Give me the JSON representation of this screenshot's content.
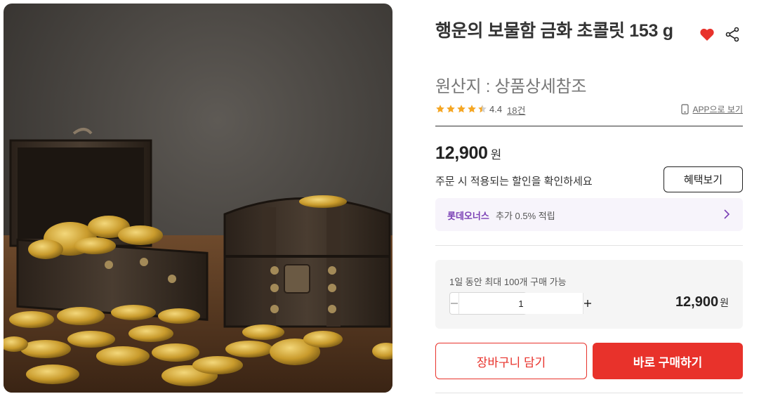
{
  "product": {
    "title": "행운의 보물함 금화 초콜릿 153 g",
    "origin": "원산지 : 상품상세참조",
    "image_alt": "treasure chests with gold coin chocolates"
  },
  "rating": {
    "score": "4.4",
    "stars": 4.4,
    "review_count": "18건",
    "star_color": "#f5a623"
  },
  "app_view_label": "APP으로 보기",
  "price": {
    "amount": "12,900",
    "unit": "원"
  },
  "discount": {
    "message": "주문 시 적용되는 할인을 확인하세요",
    "button_label": "혜택보기"
  },
  "points": {
    "brand": "롯데오너스",
    "text": "추가 0.5% 적립",
    "brand_color": "#7a3fb5"
  },
  "quantity": {
    "limit_text": "1일 동안 최대 100개 구매 가능",
    "value": "1",
    "total": "12,900",
    "total_unit": "원"
  },
  "actions": {
    "cart_label": "장바구니 담기",
    "buy_label": "바로 구매하기",
    "accent_color": "#e8322b"
  }
}
